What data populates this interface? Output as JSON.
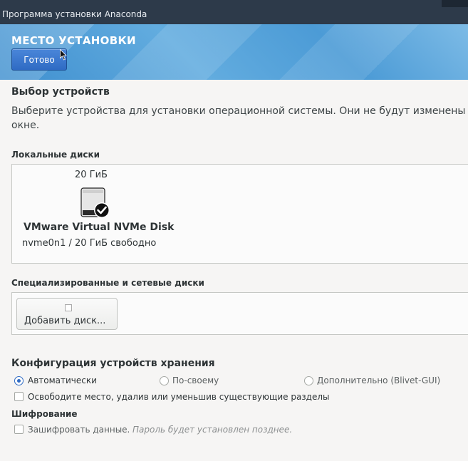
{
  "window": {
    "title": "Программа установки Anaconda"
  },
  "header": {
    "title": "МЕСТО УСТАНОВКИ",
    "done_label": "Готово"
  },
  "device_selection": {
    "title": "Выбор устройств",
    "description_line1": "Выберите устройства для установки операционной системы. Они не будут изменены до",
    "description_line2": "окне."
  },
  "local_disks": {
    "label": "Локальные диски",
    "disks": [
      {
        "size": "20 ГиБ",
        "name": "VMware Virtual NVMe Disk",
        "info": "nvme0n1  /  20 ГиБ свободно",
        "icon": "harddisk-selected-icon",
        "selected": true
      }
    ]
  },
  "specialized_disks": {
    "label": "Специализированные и сетевые диски",
    "add_button_label": "Добавить диск..."
  },
  "storage_config": {
    "title": "Конфигурация устройств хранения",
    "options": [
      {
        "label": "Автоматически",
        "selected": true
      },
      {
        "label": "По-своему",
        "selected": false
      },
      {
        "label": "Дополнительно (Blivet-GUI)",
        "selected": false
      }
    ],
    "reclaim_label": "Освободите место, удалив или уменьшив существующие разделы"
  },
  "encryption": {
    "title": "Шифрование",
    "encrypt_label": "Зашифровать данные.",
    "encrypt_hint": "Пароль будет установлен позднее."
  },
  "colors": {
    "accent": "#2f6bc4",
    "header": "#4c9bd6",
    "titlebar": "#2d3a4a"
  }
}
